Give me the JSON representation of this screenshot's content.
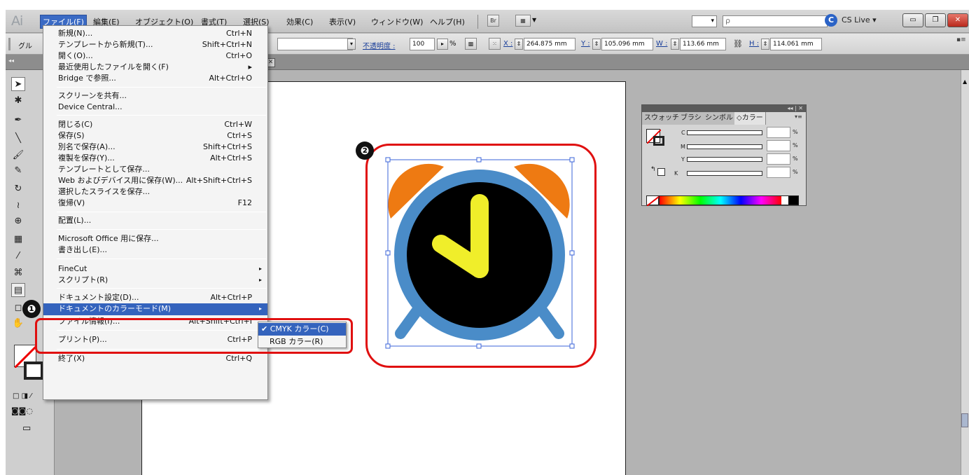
{
  "app": {
    "logo": "Ai"
  },
  "menubar": {
    "items": [
      "ファイル(F)",
      "編集(E)",
      "オブジェクト(O)",
      "書式(T)",
      "選択(S)",
      "効果(C)",
      "表示(V)",
      "ウィンドウ(W)",
      "ヘルプ(H)"
    ],
    "br_label": "Br",
    "cslive": "CS Live ▾",
    "search_placeholder": "ρ",
    "zoom_value": "▾"
  },
  "controlbar": {
    "left_label": "グル",
    "opacity_label": "不透明度 :",
    "opacity_value": "100",
    "opacity_unit": "%",
    "x_label": "X :",
    "x_value": "264.875 mm",
    "y_label": "Y :",
    "y_value": "105.096 mm",
    "w_label": "W :",
    "w_value": "113.66 mm",
    "h_label": "H :",
    "h_value": "114.061 mm"
  },
  "file_menu": {
    "items": [
      {
        "label": "新規(N)...",
        "shortcut": "Ctrl+N"
      },
      {
        "label": "テンプレートから新規(T)...",
        "shortcut": "Shift+Ctrl+N"
      },
      {
        "label": "開く(O)...",
        "shortcut": "Ctrl+O"
      },
      {
        "label": "最近使用したファイルを開く(F)",
        "shortcut": "▸"
      },
      {
        "label": "Bridge で参照...",
        "shortcut": "Alt+Ctrl+O"
      },
      {
        "label": "スクリーンを共有...",
        "shortcut": ""
      },
      {
        "label": "Device Central...",
        "shortcut": ""
      },
      {
        "label": "閉じる(C)",
        "shortcut": "Ctrl+W"
      },
      {
        "label": "保存(S)",
        "shortcut": "Ctrl+S"
      },
      {
        "label": "別名で保存(A)...",
        "shortcut": "Shift+Ctrl+S"
      },
      {
        "label": "複製を保存(Y)...",
        "shortcut": "Alt+Ctrl+S"
      },
      {
        "label": "テンプレートとして保存...",
        "shortcut": ""
      },
      {
        "label": "Web およびデバイス用に保存(W)...",
        "shortcut": "Alt+Shift+Ctrl+S"
      },
      {
        "label": "選択したスライスを保存...",
        "shortcut": ""
      },
      {
        "label": "復帰(V)",
        "shortcut": "F12"
      },
      {
        "label": "配置(L)...",
        "shortcut": ""
      },
      {
        "label": "Microsoft Office 用に保存...",
        "shortcut": ""
      },
      {
        "label": "書き出し(E)...",
        "shortcut": ""
      },
      {
        "label": "FineCut",
        "shortcut": "▸"
      },
      {
        "label": "スクリプト(R)",
        "shortcut": "▸"
      },
      {
        "label": "ドキュメント設定(D)...",
        "shortcut": "Alt+Ctrl+P"
      },
      {
        "label": "ドキュメントのカラーモード(M)",
        "shortcut": "▸"
      },
      {
        "label": "ファイル情報(I)...",
        "shortcut": "Alt+Shift+Ctrl+I"
      },
      {
        "label": "プリント(P)...",
        "shortcut": "Ctrl+P"
      },
      {
        "label": "終了(X)",
        "shortcut": "Ctrl+Q"
      }
    ]
  },
  "color_mode_submenu": {
    "items": [
      {
        "label": "✔ CMYK カラー(C)",
        "selected": true
      },
      {
        "label": "RGB カラー(R)",
        "selected": false
      }
    ]
  },
  "color_panel": {
    "tabs": [
      "スウォッチ",
      "ブラシ",
      "シンボル",
      "◇カラー"
    ],
    "channels": [
      "C",
      "M",
      "Y",
      "K"
    ],
    "unit": "%"
  },
  "annotations": {
    "badge1": "❶",
    "badge2": "❷"
  },
  "artwork": {
    "bell_color": "#ee7a12",
    "ring_color": "#4a8cc8",
    "face_color": "#000000",
    "hands_color": "#f0ee2a"
  }
}
